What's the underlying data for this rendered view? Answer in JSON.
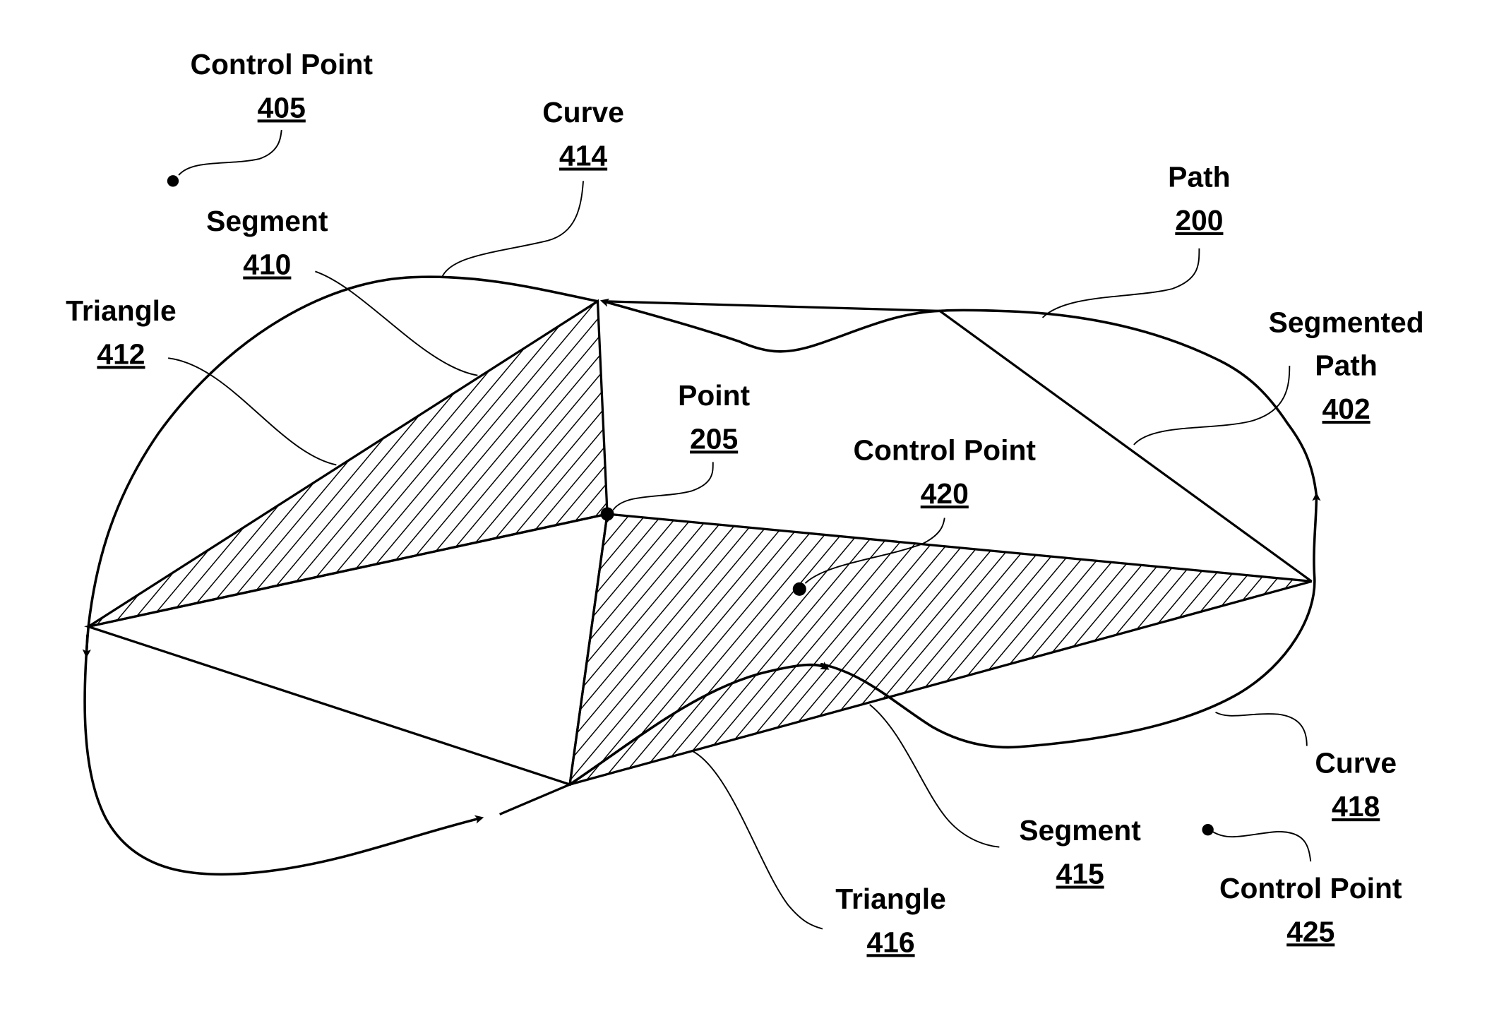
{
  "figure": {
    "labels": {
      "control_point_405": {
        "title": "Control Point",
        "number": "405"
      },
      "curve_414": {
        "title": "Curve",
        "number": "414"
      },
      "segment_410": {
        "title": "Segment",
        "number": "410"
      },
      "triangle_412": {
        "title": "Triangle",
        "number": "412"
      },
      "path_200": {
        "title": "Path",
        "number": "200"
      },
      "segmented_path_402": {
        "title_line1": "Segmented",
        "title_line2": "Path",
        "number": "402"
      },
      "point_205": {
        "title": "Point",
        "number": "205"
      },
      "control_point_420": {
        "title": "Control Point",
        "number": "420"
      },
      "curve_418": {
        "title": "Curve",
        "number": "418"
      },
      "segment_415": {
        "title": "Segment",
        "number": "415"
      },
      "triangle_416": {
        "title": "Triangle",
        "number": "416"
      },
      "control_point_425": {
        "title": "Control Point",
        "number": "425"
      }
    },
    "colors": {
      "ink": "#000000",
      "background": "#ffffff"
    }
  }
}
